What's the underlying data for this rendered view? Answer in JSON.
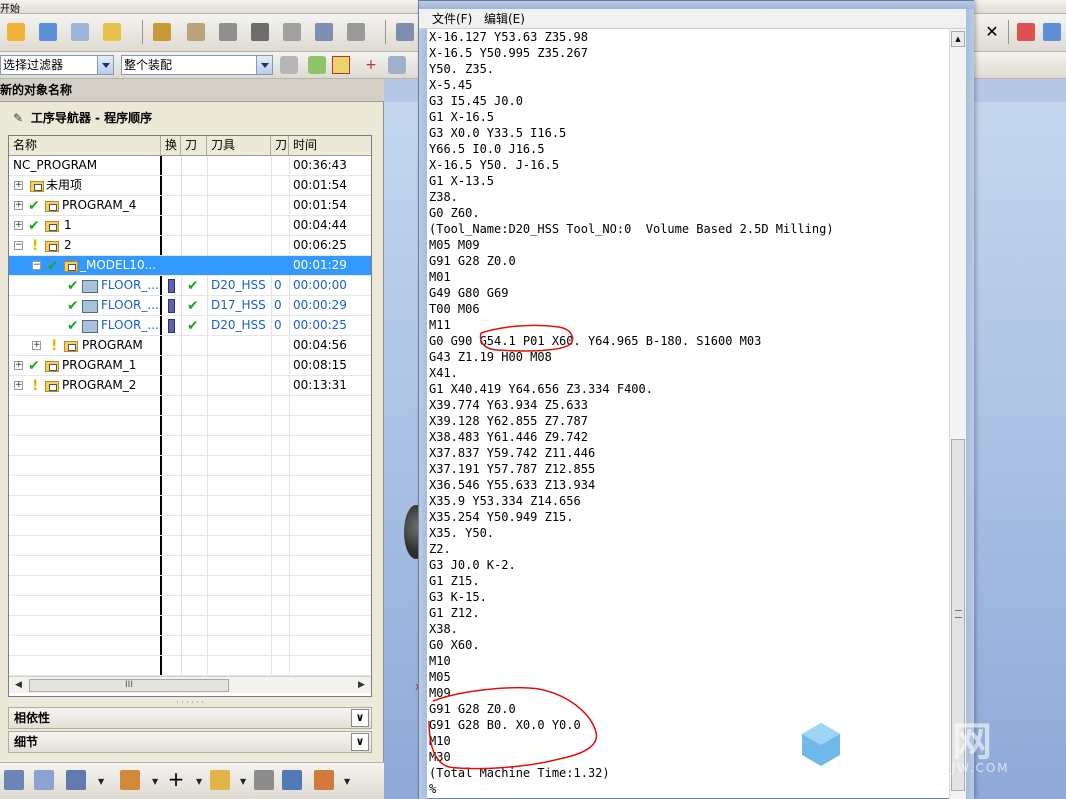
{
  "toolbar": {
    "start_label": "开始",
    "filter_combo": "选择过滤器",
    "assembly_combo": "整个装配"
  },
  "panel": {
    "title_bar": "新的对象名称",
    "nav_title": "工序导航器 - 程序顺序",
    "columns": [
      "名称",
      "换",
      "刀",
      "刀具",
      "刀",
      "时间"
    ],
    "rows": [
      {
        "name": "NC_PROGRAM",
        "time": "00:36:43"
      },
      {
        "name": "未用项",
        "time": "00:01:54"
      },
      {
        "name": "PROGRAM_4",
        "time": "00:01:54"
      },
      {
        "name": "1",
        "time": "00:04:44"
      },
      {
        "name": "2",
        "time": "00:06:25"
      },
      {
        "name": "_MODEL10...",
        "time": "00:01:29"
      },
      {
        "name": "FLOOR_...",
        "tool": "D20_HSS",
        "num": "0",
        "time": "00:00:00"
      },
      {
        "name": "FLOOR_...",
        "tool": "D17_HSS",
        "num": "0",
        "time": "00:00:29"
      },
      {
        "name": "FLOOR_...",
        "tool": "D20_HSS",
        "num": "0",
        "time": "00:00:25"
      },
      {
        "name": "PROGRAM",
        "time": "00:04:56"
      },
      {
        "name": "PROGRAM_1",
        "time": "00:08:15"
      },
      {
        "name": "PROGRAM_2",
        "time": "00:13:31"
      }
    ],
    "scroll_thumb": "III",
    "sections": [
      "相依性",
      "细节"
    ]
  },
  "notepad": {
    "menu": [
      "文件(F)",
      "编辑(E)"
    ],
    "lines": [
      "X-16.127 Y53.63 Z35.98",
      "X-16.5 Y50.995 Z35.267",
      "Y50. Z35.",
      "X-5.45",
      "G3 I5.45 J0.0",
      "G1 X-16.5",
      "G3 X0.0 Y33.5 I16.5",
      "Y66.5 I0.0 J16.5",
      "X-16.5 Y50. J-16.5",
      "G1 X-13.5",
      "Z38.",
      "G0 Z60.",
      "(Tool_Name:D20_HSS Tool_NO:0  Volume Based 2.5D Milling)",
      "M05 M09",
      "G91 G28 Z0.0",
      "M01",
      "G49 G80 G69",
      "T00 M06",
      "M11",
      "G0 G90 G54.1 P01 X60. Y64.965 B-180. S1600 M03",
      "G43 Z1.19 H00 M08",
      "X41.",
      "G1 X40.419 Y64.656 Z3.334 F400.",
      "X39.774 Y63.934 Z5.633",
      "X39.128 Y62.855 Z7.787",
      "X38.483 Y61.446 Z9.742",
      "X37.837 Y59.742 Z11.446",
      "X37.191 Y57.787 Z12.855",
      "X36.546 Y55.633 Z13.934",
      "X35.9 Y53.334 Z14.656",
      "X35.254 Y50.949 Z15.",
      "X35. Y50.",
      "Z2.",
      "G3 J0.0 K-2.",
      "G1 Z15.",
      "G3 K-15.",
      "G1 Z12.",
      "X38.",
      "G0 X60.",
      "M10",
      "M05",
      "M09",
      "G91 G28 Z0.0",
      "G91 G28 B0. X0.0 Y0.0",
      "M10",
      "M30",
      "(Total Machine Time:1.32)",
      "%"
    ]
  },
  "watermark": {
    "text": "世界网",
    "sub": "SJW.COM"
  },
  "colors": {
    "selection": "#3399ff",
    "annotation": "#e01010",
    "check": "#1ea81e",
    "graphics_bg": "#a8bfe3"
  }
}
